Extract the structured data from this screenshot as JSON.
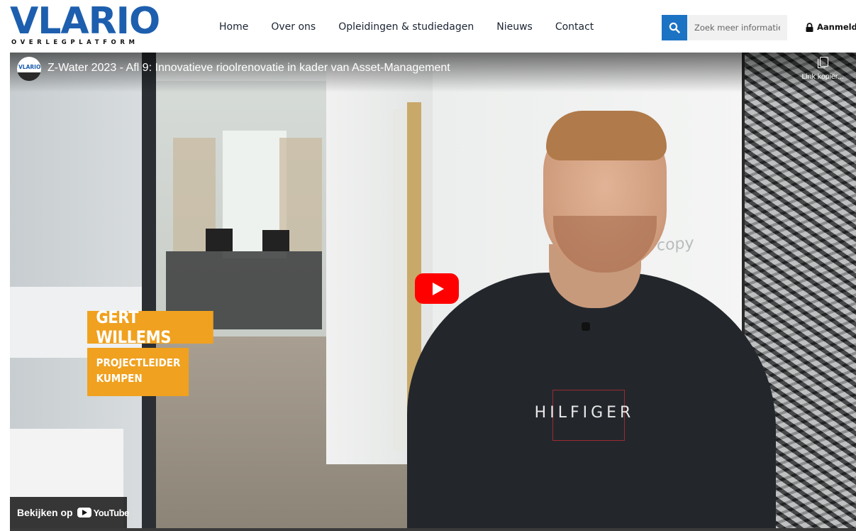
{
  "brand": {
    "logo_text": "VLARIO",
    "logo_subtext": "OVERLEGPLATFORM",
    "logo_color": "#1d5fae"
  },
  "nav": {
    "items": [
      {
        "label": "Home"
      },
      {
        "label": "Over ons"
      },
      {
        "label": "Opleidingen & studiedagen"
      },
      {
        "label": "Nieuws"
      },
      {
        "label": "Contact"
      }
    ]
  },
  "search": {
    "placeholder": "Zoek meer informatie",
    "icon": "search-icon",
    "button_color": "#1c73c4"
  },
  "login": {
    "label": "Aanmelden",
    "icon": "lock-icon"
  },
  "video": {
    "channel_avatar_text": "VLARIO",
    "title": "Z-Water 2023 - Afl 9: Innovatieve rioolrenovatie in kader van Asset-Management",
    "copy_link_label": "Link kopiër...",
    "lower_third_name": "GERT WILLEMS",
    "lower_third_role_line1": "PROJECTLEIDER",
    "lower_third_role_line2": "KUMPEN",
    "lower_third_color": "#f0a11f",
    "shirt_text": "HILFIGER",
    "background_text": "copy",
    "watch_on_label": "Bekijken op",
    "watch_on_brand": "YouTube",
    "play_button_color": "#ff0000"
  }
}
